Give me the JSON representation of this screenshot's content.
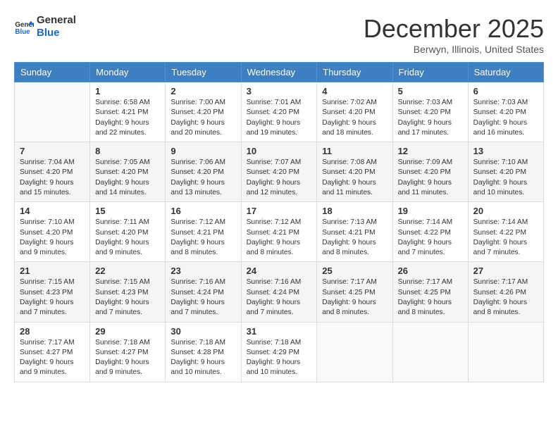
{
  "header": {
    "logo_line1": "General",
    "logo_line2": "Blue",
    "month": "December 2025",
    "location": "Berwyn, Illinois, United States"
  },
  "weekdays": [
    "Sunday",
    "Monday",
    "Tuesday",
    "Wednesday",
    "Thursday",
    "Friday",
    "Saturday"
  ],
  "weeks": [
    [
      {
        "day": "",
        "info": ""
      },
      {
        "day": "1",
        "info": "Sunrise: 6:58 AM\nSunset: 4:21 PM\nDaylight: 9 hours\nand 22 minutes."
      },
      {
        "day": "2",
        "info": "Sunrise: 7:00 AM\nSunset: 4:20 PM\nDaylight: 9 hours\nand 20 minutes."
      },
      {
        "day": "3",
        "info": "Sunrise: 7:01 AM\nSunset: 4:20 PM\nDaylight: 9 hours\nand 19 minutes."
      },
      {
        "day": "4",
        "info": "Sunrise: 7:02 AM\nSunset: 4:20 PM\nDaylight: 9 hours\nand 18 minutes."
      },
      {
        "day": "5",
        "info": "Sunrise: 7:03 AM\nSunset: 4:20 PM\nDaylight: 9 hours\nand 17 minutes."
      },
      {
        "day": "6",
        "info": "Sunrise: 7:03 AM\nSunset: 4:20 PM\nDaylight: 9 hours\nand 16 minutes."
      }
    ],
    [
      {
        "day": "7",
        "info": "Sunrise: 7:04 AM\nSunset: 4:20 PM\nDaylight: 9 hours\nand 15 minutes."
      },
      {
        "day": "8",
        "info": "Sunrise: 7:05 AM\nSunset: 4:20 PM\nDaylight: 9 hours\nand 14 minutes."
      },
      {
        "day": "9",
        "info": "Sunrise: 7:06 AM\nSunset: 4:20 PM\nDaylight: 9 hours\nand 13 minutes."
      },
      {
        "day": "10",
        "info": "Sunrise: 7:07 AM\nSunset: 4:20 PM\nDaylight: 9 hours\nand 12 minutes."
      },
      {
        "day": "11",
        "info": "Sunrise: 7:08 AM\nSunset: 4:20 PM\nDaylight: 9 hours\nand 11 minutes."
      },
      {
        "day": "12",
        "info": "Sunrise: 7:09 AM\nSunset: 4:20 PM\nDaylight: 9 hours\nand 11 minutes."
      },
      {
        "day": "13",
        "info": "Sunrise: 7:10 AM\nSunset: 4:20 PM\nDaylight: 9 hours\nand 10 minutes."
      }
    ],
    [
      {
        "day": "14",
        "info": "Sunrise: 7:10 AM\nSunset: 4:20 PM\nDaylight: 9 hours\nand 9 minutes."
      },
      {
        "day": "15",
        "info": "Sunrise: 7:11 AM\nSunset: 4:20 PM\nDaylight: 9 hours\nand 9 minutes."
      },
      {
        "day": "16",
        "info": "Sunrise: 7:12 AM\nSunset: 4:21 PM\nDaylight: 9 hours\nand 8 minutes."
      },
      {
        "day": "17",
        "info": "Sunrise: 7:12 AM\nSunset: 4:21 PM\nDaylight: 9 hours\nand 8 minutes."
      },
      {
        "day": "18",
        "info": "Sunrise: 7:13 AM\nSunset: 4:21 PM\nDaylight: 9 hours\nand 8 minutes."
      },
      {
        "day": "19",
        "info": "Sunrise: 7:14 AM\nSunset: 4:22 PM\nDaylight: 9 hours\nand 7 minutes."
      },
      {
        "day": "20",
        "info": "Sunrise: 7:14 AM\nSunset: 4:22 PM\nDaylight: 9 hours\nand 7 minutes."
      }
    ],
    [
      {
        "day": "21",
        "info": "Sunrise: 7:15 AM\nSunset: 4:23 PM\nDaylight: 9 hours\nand 7 minutes."
      },
      {
        "day": "22",
        "info": "Sunrise: 7:15 AM\nSunset: 4:23 PM\nDaylight: 9 hours\nand 7 minutes."
      },
      {
        "day": "23",
        "info": "Sunrise: 7:16 AM\nSunset: 4:24 PM\nDaylight: 9 hours\nand 7 minutes."
      },
      {
        "day": "24",
        "info": "Sunrise: 7:16 AM\nSunset: 4:24 PM\nDaylight: 9 hours\nand 7 minutes."
      },
      {
        "day": "25",
        "info": "Sunrise: 7:17 AM\nSunset: 4:25 PM\nDaylight: 9 hours\nand 8 minutes."
      },
      {
        "day": "26",
        "info": "Sunrise: 7:17 AM\nSunset: 4:25 PM\nDaylight: 9 hours\nand 8 minutes."
      },
      {
        "day": "27",
        "info": "Sunrise: 7:17 AM\nSunset: 4:26 PM\nDaylight: 9 hours\nand 8 minutes."
      }
    ],
    [
      {
        "day": "28",
        "info": "Sunrise: 7:17 AM\nSunset: 4:27 PM\nDaylight: 9 hours\nand 9 minutes."
      },
      {
        "day": "29",
        "info": "Sunrise: 7:18 AM\nSunset: 4:27 PM\nDaylight: 9 hours\nand 9 minutes."
      },
      {
        "day": "30",
        "info": "Sunrise: 7:18 AM\nSunset: 4:28 PM\nDaylight: 9 hours\nand 10 minutes."
      },
      {
        "day": "31",
        "info": "Sunrise: 7:18 AM\nSunset: 4:29 PM\nDaylight: 9 hours\nand 10 minutes."
      },
      {
        "day": "",
        "info": ""
      },
      {
        "day": "",
        "info": ""
      },
      {
        "day": "",
        "info": ""
      }
    ]
  ]
}
